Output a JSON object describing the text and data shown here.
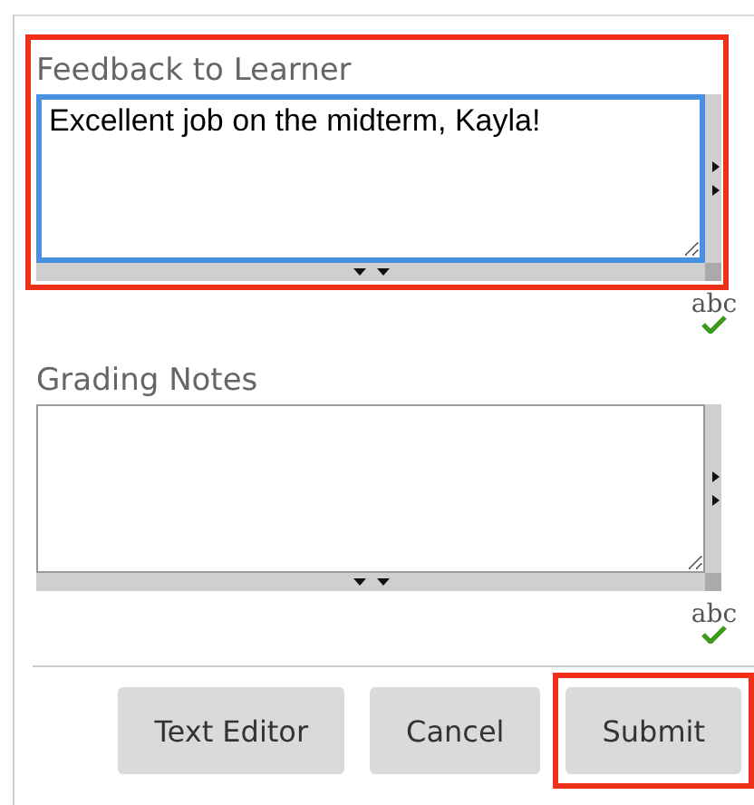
{
  "fields": [
    {
      "label": "Feedback to Learner",
      "value": "Excellent job on the midterm, Kayla!",
      "focused": true,
      "highlighted": true,
      "spellcheck": "abc"
    },
    {
      "label": "Grading Notes",
      "focused": false,
      "highlighted": false,
      "spellcheck": "abc"
    }
  ],
  "buttons": [
    {
      "label": "Text Editor",
      "highlighted": false
    },
    {
      "label": "Cancel",
      "highlighted": false
    },
    {
      "label": "Submit",
      "highlighted": true
    }
  ]
}
